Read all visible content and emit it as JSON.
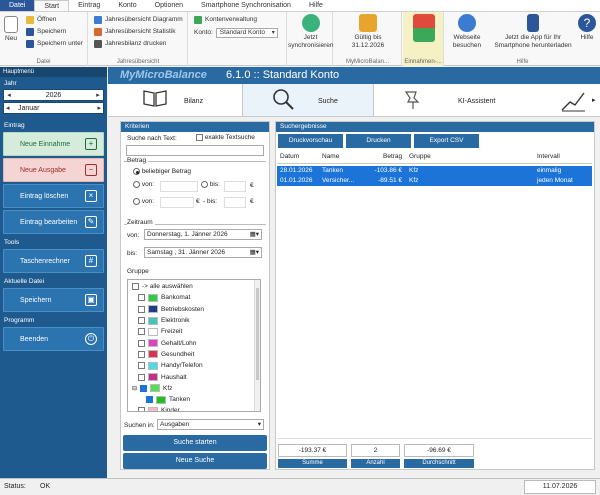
{
  "ribbon_tabs": [
    "Datei",
    "Start",
    "Eintrag",
    "Konto",
    "Optionen",
    "Smartphone Synchronisation",
    "Hilfe"
  ],
  "ribbon": {
    "neu": "Neu",
    "oeffnen": "Öffnen",
    "speichern": "Speichern",
    "speichern_unter": "Speichern unter",
    "datei_group": "Datei",
    "jahr_diagramm": "Jahresübersicht Diagramm",
    "jahr_statistik": "Jahresübersicht Statistik",
    "jahresbilanz": "Jahresbilanz drucken",
    "jahr_group": "Jahresübersicht",
    "kontenverwaltung": "Kontenverwaltung",
    "konto_label": "Konto:",
    "konto_value": "Standard Konto",
    "sync_line1": "Jetzt",
    "sync_line2": "synchronisieren",
    "gueltig_line1": "Gültig bis",
    "gueltig_line2": "31.12.2026",
    "mymb_group": "MyMicroBalan...",
    "einnahmen_group": "Einnahmen-...",
    "webseite_line1": "Webseite",
    "webseite_line2": "besuchen",
    "app_line1": "Jetzt die App für Ihr",
    "app_line2": "Smartphone herunterladen",
    "hilfe_group": "Hilfe",
    "hilfe": "Hilfe"
  },
  "nav": {
    "header": "Hauptmenü",
    "jahr_label": "Jahr",
    "year": "2026",
    "month": "Januar",
    "eintrag_label": "Eintrag",
    "neue_einnahme": "Neue Einnahme",
    "neue_ausgabe": "Neue Ausgabe",
    "eintrag_loeschen": "Eintrag löschen",
    "eintrag_bearbeiten": "Eintrag bearbeiten",
    "tools_label": "Tools",
    "taschenrechner": "Taschenrechner",
    "aktuelle_datei_label": "Aktuelle Datei",
    "speichern": "Speichern",
    "programm_label": "Programm",
    "beenden": "Beenden"
  },
  "title": {
    "brand": "MyMicroBalance",
    "text": "6.1.0 :: Standard Konto"
  },
  "modes": [
    "Bilanz",
    "Suche",
    "KI-Assistent"
  ],
  "criteria": {
    "header": "Kriterien",
    "suche_nach_text": "Suche nach Text:",
    "exakte_textsuche": "exakte Textsuche",
    "betrag_label": "Betrag",
    "beliebiger_betrag": "beliebiger Betrag",
    "von": "von:",
    "bis": "bis:",
    "minus_bis": "- bis:",
    "euro": "€",
    "zeitraum_label": "Zeitraum",
    "von_date": "Donnerstag,  1.  Jänner  2026",
    "bis_date": "Samstag  , 31.  Jänner  2026",
    "gruppe_label": "Gruppe",
    "suchen_in_label": "Suchen in:",
    "suchen_in_value": "Ausgaben",
    "suche_starten": "Suche starten",
    "neue_suche": "Neue Suche"
  },
  "groups": [
    {
      "label": "-> alle auswählen",
      "color": ""
    },
    {
      "label": "Bankomat",
      "color": "#2ecc40"
    },
    {
      "label": "Betriebskosten",
      "color": "#1f3d8c"
    },
    {
      "label": "Elektronik",
      "color": "#43c6b8"
    },
    {
      "label": "Freizeit",
      "color": "#ffffff"
    },
    {
      "label": "Gehalt/Lohn",
      "color": "#e040c8"
    },
    {
      "label": "Gesundheit",
      "color": "#e03050"
    },
    {
      "label": "Handy/Telefon",
      "color": "#50d8e8"
    },
    {
      "label": "Haushalt",
      "color": "#c0308c"
    },
    {
      "label": "Kfz",
      "color": "#50e050"
    },
    {
      "label": "Tanken",
      "color": "#20c020"
    },
    {
      "label": "Kinder",
      "color": "#f2b8c8"
    }
  ],
  "results": {
    "header": "Suchergebnisse",
    "druckvorschau": "Druckvorschau",
    "drucken": "Drucken",
    "export_csv": "Export CSV",
    "columns": [
      "Datum",
      "Name",
      "Betrag",
      "Gruppe",
      "Intervall"
    ],
    "rows": [
      {
        "datum": "28.01.2026",
        "name": "Tanken",
        "betrag": "-103.86 €",
        "gruppe": "Kfz",
        "intervall": "einmalig"
      },
      {
        "datum": "01.01.2026",
        "name": "Versicher...",
        "betrag": "-89.51 €",
        "gruppe": "Kfz",
        "intervall": "jeden Monat"
      }
    ],
    "summe_value": "-193.37 €",
    "summe_label": "Summe",
    "anzahl_value": "2",
    "anzahl_label": "Anzahl",
    "durchschnitt_value": "-96.69 €",
    "durchschnitt_label": "Durchschnitt"
  },
  "status": {
    "label": "Status:",
    "value": "OK",
    "date": "11.07.2026"
  }
}
